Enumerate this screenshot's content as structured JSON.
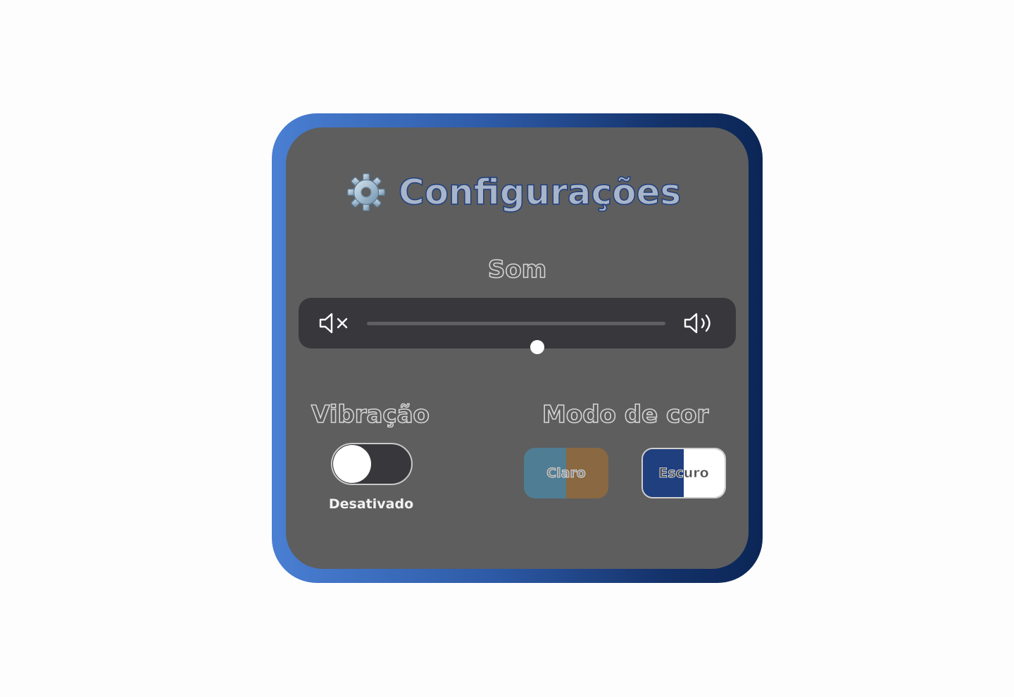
{
  "settings": {
    "title": "Configurações",
    "icon": "gear-icon",
    "sound": {
      "label": "Som",
      "min_icon": "speaker-mute-icon",
      "max_icon": "speaker-loud-icon",
      "volume": 0.57
    },
    "vibration": {
      "label": "Vibração",
      "enabled": false,
      "status": "Desativado"
    },
    "color_mode": {
      "label": "Modo de cor",
      "options": [
        {
          "label": "Claro",
          "colors": [
            "#4f7d93",
            "#8a6842"
          ]
        },
        {
          "label": "Escuro",
          "colors": [
            "#1f3f7e",
            "#ffffff"
          ]
        }
      ]
    }
  },
  "colors": {
    "frame_gradient_start": "#4a7fd3",
    "frame_gradient_end": "#0b2656",
    "panel_bg": "#5e5e5e",
    "control_bg": "#38383c",
    "title_fill": "#a8b4c8",
    "title_stroke": "#1f3f7e"
  }
}
